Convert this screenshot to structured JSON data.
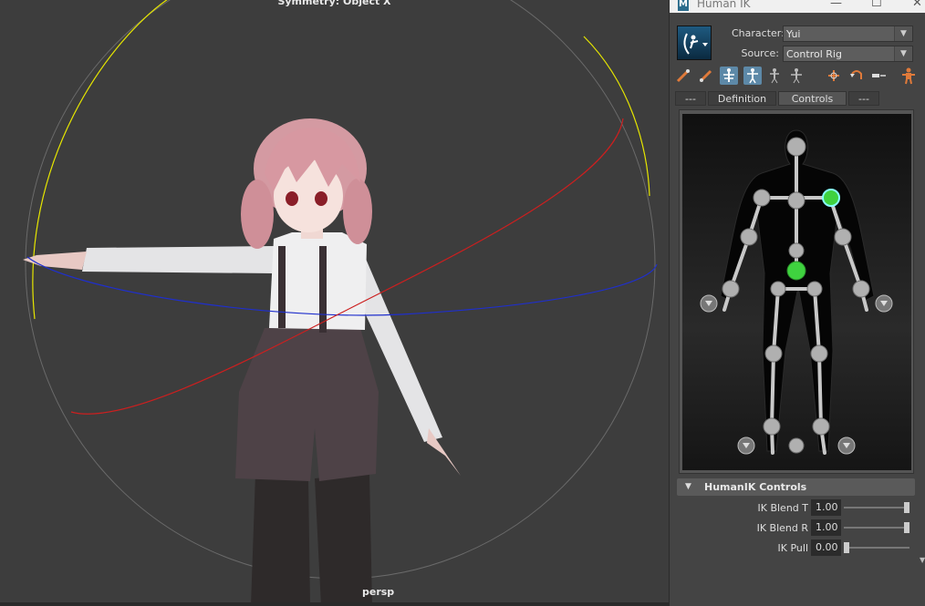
{
  "viewport": {
    "header": "Symmetry: Object X",
    "camera": "persp"
  },
  "panel": {
    "title": "Human IK",
    "window_buttons": {
      "minimize": "—",
      "maximize": "☐",
      "close": "✕"
    },
    "character_label": "Character:",
    "character_value": "Yui",
    "source_label": "Source:",
    "source_value": "Control Rig",
    "tabs": [
      {
        "label": "---",
        "active": false
      },
      {
        "label": "Definition",
        "active": false
      },
      {
        "label": "Controls",
        "active": true
      },
      {
        "label": "---",
        "active": false
      }
    ],
    "toolbar_icons": [
      "pin-translation-icon",
      "pin-rotation-icon",
      "full-body-icon",
      "body-part-icon",
      "selection-icon",
      "stance-icon",
      "reset-pose-icon",
      "undo-pose-icon",
      "mirror-icon",
      "character-icon"
    ],
    "section_title": "HumanIK Controls",
    "properties": [
      {
        "label": "IK Blend T",
        "value": "1.00",
        "fraction": 1.0
      },
      {
        "label": "IK Blend R",
        "value": "1.00",
        "fraction": 1.0
      },
      {
        "label": "IK Pull",
        "value": "0.00",
        "fraction": 0.0
      }
    ]
  },
  "colors": {
    "viewport_bg": "#3d3d3d",
    "panel_bg": "#444444",
    "active_node": "#3fd23f",
    "inactive_node": "#b0b0b0",
    "accent_blue": "#5d89a8",
    "gizmo_yellow": "#e6e600",
    "gizmo_red": "#cc1f1f",
    "gizmo_blue": "#1f2fcc"
  }
}
